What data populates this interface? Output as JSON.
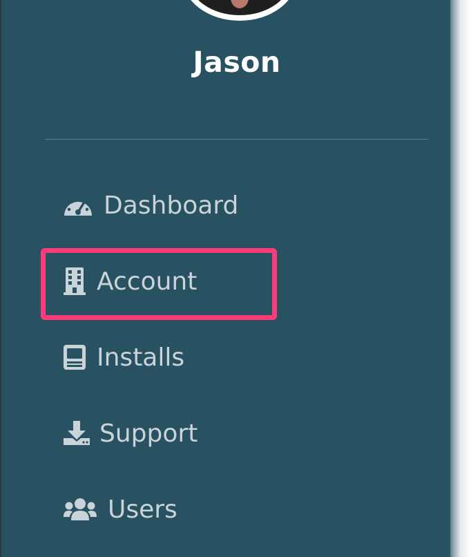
{
  "user": {
    "name": "Jason"
  },
  "nav": {
    "items": [
      {
        "label": "Dashboard",
        "icon": "dashboard-gauge-icon"
      },
      {
        "label": "Account",
        "icon": "building-icon"
      },
      {
        "label": "Installs",
        "icon": "computer-icon"
      },
      {
        "label": "Support",
        "icon": "download-icon"
      },
      {
        "label": "Users",
        "icon": "users-icon"
      }
    ]
  },
  "colors": {
    "sidebar_bg": "#285162",
    "text_muted": "#c9d3d8",
    "name_text": "#ffffff",
    "highlight": "#ff3b7a"
  }
}
